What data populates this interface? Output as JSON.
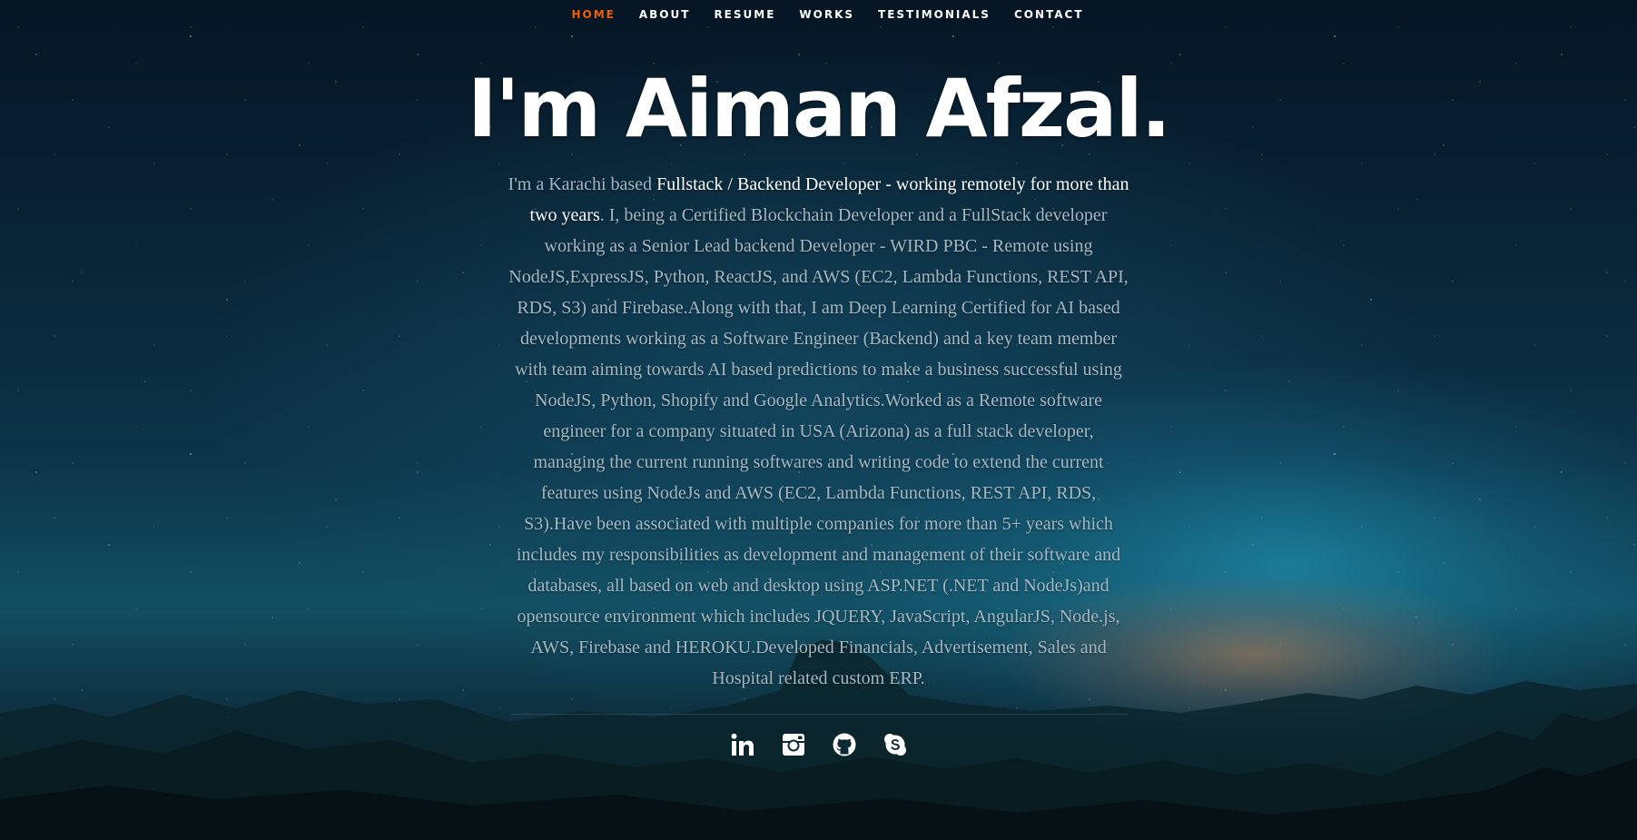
{
  "nav": {
    "items": [
      {
        "label": "HOME",
        "active": true
      },
      {
        "label": "ABOUT",
        "active": false
      },
      {
        "label": "RESUME",
        "active": false
      },
      {
        "label": "WORKS",
        "active": false
      },
      {
        "label": "TESTIMONIALS",
        "active": false
      },
      {
        "label": "CONTACT",
        "active": false
      }
    ],
    "active_color": "#f06000"
  },
  "banner": {
    "headline": "I'm Aiman Afzal.",
    "intro": {
      "part1": "I'm a Karachi based ",
      "highlight": "Fullstack / Backend Developer - working remotely for more than two years",
      "part2": ". I, being a Certified Blockchain Developer and a FullStack developer working as a Senior Lead backend Developer - WIRD PBC - Remote using NodeJS,ExpressJS, Python, ReactJS, and AWS (EC2, Lambda Functions, REST API, RDS, S3) and Firebase.Along with that, I am Deep Learning Certified for AI based developments working as a Software Engineer (Backend) and a key team member with team aiming towards AI based predictions to make a business successful using NodeJS, Python, Shopify and Google Analytics.Worked as a Remote software engineer for a company situated in USA (Arizona) as a full stack developer, managing the current running softwares and writing code to extend the current features using NodeJs and AWS (EC2, Lambda Functions, REST API, RDS, S3).Have been associated with multiple companies for more than 5+ years which includes my responsibilities as development and management of their software and databases, all based on web and desktop using ASP.NET (.NET and NodeJs)and opensource environment which includes JQUERY, JavaScript, AngularJS, Node.js, AWS, Firebase and HEROKU.Developed Financials, Advertisement, Sales and Hospital related custom ERP."
    }
  },
  "social": {
    "icons": [
      "linkedin-icon",
      "instagram-icon",
      "github-icon",
      "skype-icon"
    ]
  }
}
